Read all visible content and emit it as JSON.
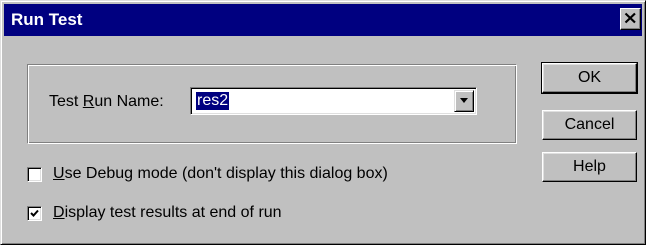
{
  "window": {
    "title": "Run Test",
    "close_icon": "close-icon"
  },
  "run_name": {
    "label_pre": "Test ",
    "label_mnemonic": "R",
    "label_post": "un Name:",
    "value": "res2",
    "dropdown_icon": "chevron-down-icon"
  },
  "buttons": {
    "ok": "OK",
    "cancel": "Cancel",
    "help": "Help"
  },
  "options": [
    {
      "mnemonic": "U",
      "label_rest": "se Debug mode (don't display this dialog box)",
      "checked": false
    },
    {
      "mnemonic": "D",
      "label_rest": "isplay test results at end of run",
      "checked": true
    }
  ],
  "colors": {
    "face": "#c0c0c0",
    "title_bar": "#000080",
    "selection": "#000080"
  }
}
